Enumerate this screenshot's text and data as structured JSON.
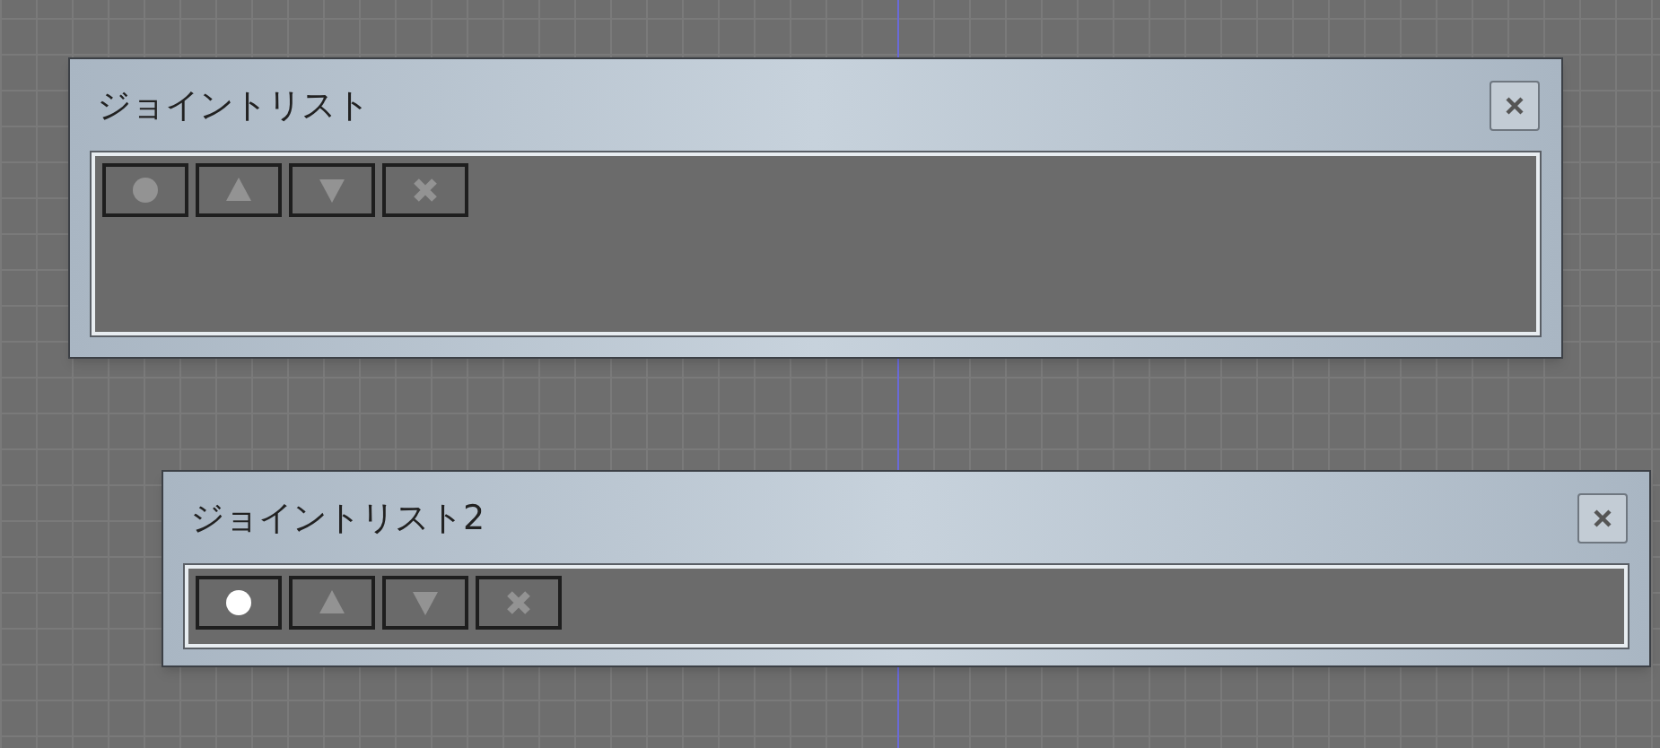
{
  "windows": [
    {
      "title": "ジョイントリスト",
      "tools": [
        {
          "kind": "add",
          "disabled": true
        },
        {
          "kind": "up",
          "disabled": true
        },
        {
          "kind": "down",
          "disabled": true
        },
        {
          "kind": "delete",
          "disabled": true
        }
      ]
    },
    {
      "title": "ジョイントリスト2",
      "tools": [
        {
          "kind": "add",
          "disabled": false
        },
        {
          "kind": "up",
          "disabled": true
        },
        {
          "kind": "down",
          "disabled": true
        },
        {
          "kind": "delete",
          "disabled": true
        }
      ]
    }
  ]
}
